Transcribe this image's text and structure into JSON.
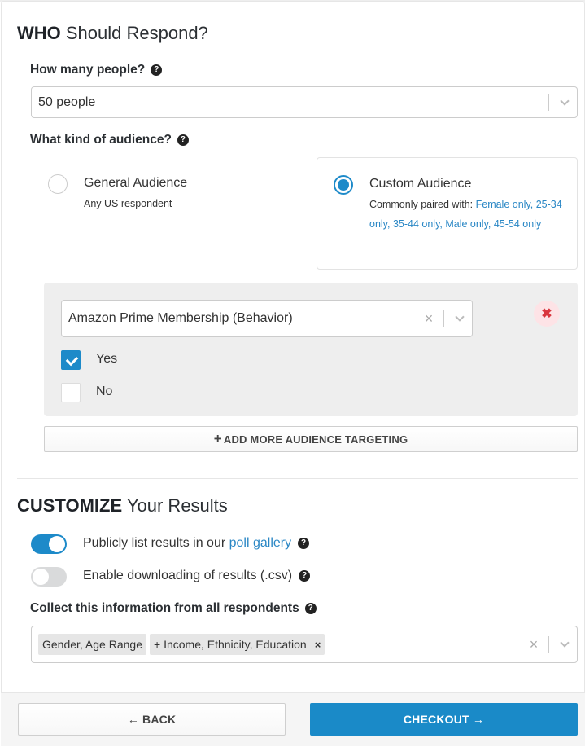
{
  "who": {
    "title_bold": "WHO",
    "title_rest": " Should Respond?",
    "how_many_label": "How many people?",
    "how_many_value": "50 people",
    "audience_label": "What kind of audience?",
    "help_glyph": "?",
    "options": [
      {
        "title": "General Audience",
        "subtitle": "Any US respondent",
        "selected": false
      },
      {
        "title": "Custom Audience",
        "subtitle_prefix": "Commonly paired with: ",
        "subtitle_links": "Female only, 25-34 only, 35-44 only, Male only, 45-54 only",
        "selected": true
      }
    ]
  },
  "targeting": {
    "attribute_value": "Amazon Prime Membership (Behavior)",
    "choices": [
      {
        "label": "Yes",
        "checked": true
      },
      {
        "label": "No",
        "checked": false
      }
    ],
    "remove_glyph": "✖",
    "clear_glyph": "×",
    "add_more_label": "ADD MORE AUDIENCE TARGETING",
    "add_more_glyph": "+"
  },
  "customize": {
    "title_bold": "CUSTOMIZE",
    "title_rest": " Your Results",
    "toggles": [
      {
        "label_prefix": "Publicly list results in our ",
        "label_link": "poll gallery",
        "on": true
      },
      {
        "label_prefix": "Enable downloading of results (.csv)",
        "label_link": "",
        "on": false
      }
    ],
    "collect_label": "Collect this information from all respondents",
    "collect_tags": [
      {
        "label": "Gender, Age Range",
        "removable": false
      },
      {
        "label": "+ Income, Ethnicity, Education",
        "removable": true,
        "remove_glyph": "×"
      }
    ],
    "clear_glyph": "×"
  },
  "footer": {
    "back_label": "← BACK",
    "checkout_label": "CHECKOUT →"
  },
  "colors": {
    "accent": "#1a8ac8",
    "link": "#2a87c5",
    "danger": "#d9363e"
  }
}
